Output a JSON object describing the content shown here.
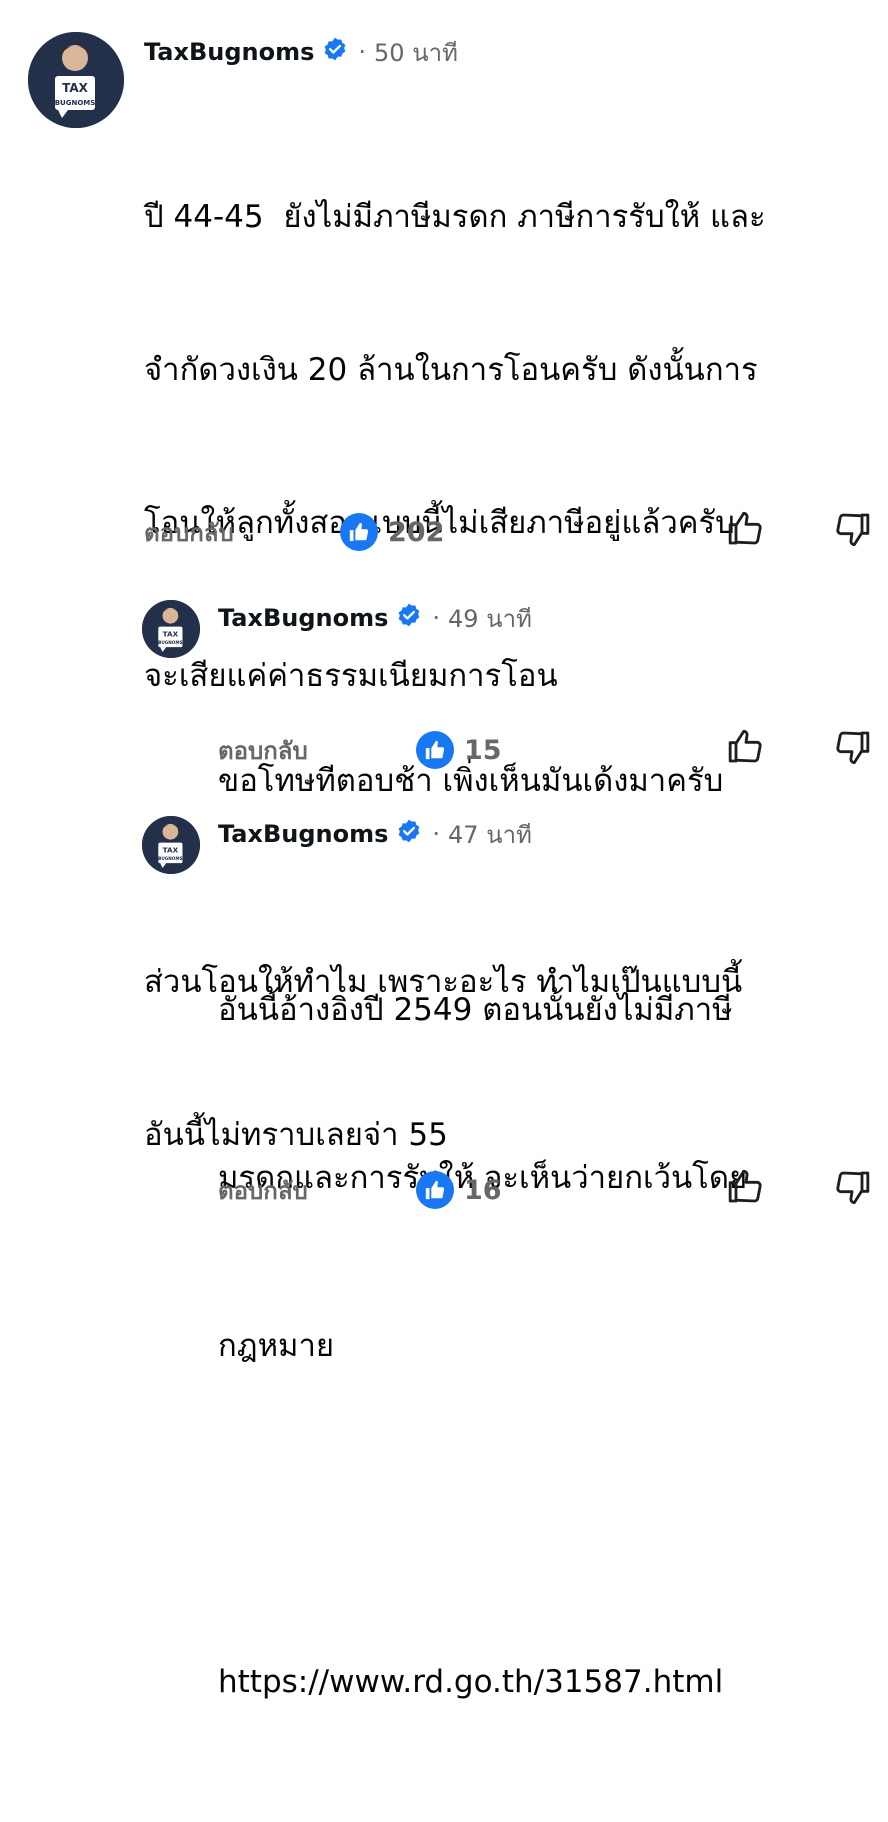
{
  "comments": [
    {
      "author": "TaxBugnoms",
      "verified": true,
      "separator": "·",
      "time": "50 นาที",
      "lines": [
        "ปี 44-45  ยังไม่มีภาษีมรดก ภาษีการรับให้ และ",
        "จำกัดวงเงิน 20 ล้านในการโอนครับ ดังนั้นการ",
        "โอนให้ลูกทั้งสองแบบนี้ไม่เสียภาษีอยู่แล้วครับ",
        "จะเสียแค่ค่าธรรมเนียมการโอน",
        "",
        "ส่วนโอนให้ทำไม เพราะอะไร ทำไมเป๊นแบบนี้",
        "อันนี้ไม่ทราบเลยจ่า 55"
      ],
      "reply_label": "ตอบกลับ",
      "reaction_count": "202"
    },
    {
      "author": "TaxBugnoms",
      "verified": true,
      "separator": "·",
      "time": "49 นาที",
      "lines": [
        "ขอโทษทีตอบช้า เพิ่งเห็นมันเด้งมาครับ"
      ],
      "reply_label": "ตอบกลับ",
      "reaction_count": "15"
    },
    {
      "author": "TaxBugnoms",
      "verified": true,
      "separator": "·",
      "time": "47 นาที",
      "lines": [
        "อันนี้อ้างอิงปี 2549 ตอนนั้นยังไม่มีภาษี",
        "มรดกและการรับให้ จะเห็นว่ายกเว้นโดย",
        "กฎหมาย",
        "",
        "https://www.rd.go.th/31587.html"
      ],
      "reply_label": "ตอบกลับ",
      "reaction_count": "16"
    }
  ],
  "avatar": {
    "logo_text_top": "TAX",
    "logo_text_small": "by",
    "logo_text_bottom": "BUGNOMS"
  },
  "icons": {
    "verified": "verified-badge-icon",
    "like_badge": "thumbs-up-badge-icon",
    "like": "thumbs-up-outline-icon",
    "dislike": "thumbs-down-outline-icon"
  },
  "colors": {
    "like_blue": "#1877f2",
    "verified_blue": "#1877f2",
    "muted": "#65676b",
    "text": "#050505"
  }
}
